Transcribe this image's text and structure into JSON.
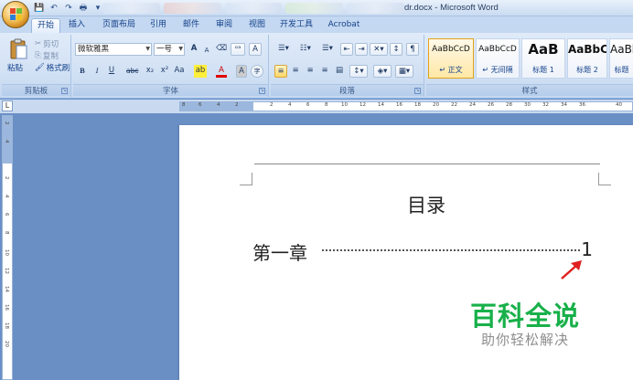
{
  "window": {
    "title": "dr.docx - Microsoft Word"
  },
  "quick_access": {
    "save": "💾",
    "undo": "↶",
    "redo": "↷",
    "print": "🖶",
    "more": "▾"
  },
  "tabs": [
    "开始",
    "插入",
    "页面布局",
    "引用",
    "邮件",
    "审阅",
    "视图",
    "开发工具",
    "Acrobat"
  ],
  "clipboard": {
    "paste": "粘贴",
    "cut": "剪切",
    "copy": "复制",
    "format_painter": "格式刷",
    "group_label": "剪贴板"
  },
  "font": {
    "family": "微软雅黑",
    "size": "一号",
    "grow": "A",
    "shrink": "A",
    "phonetic": "ᵒᵃ",
    "char_border": "A",
    "bold": "B",
    "italic": "I",
    "underline": "U",
    "strike": "abc",
    "subscript": "x₂",
    "superscript": "x²",
    "change_case": "Aa",
    "highlight": "ab",
    "font_color": "A",
    "shading": "A",
    "enclose": "字",
    "group_label": "字体"
  },
  "paragraph": {
    "group_label": "段落"
  },
  "styles": {
    "group_label": "样式",
    "items": [
      {
        "sample": "AaBbCcD",
        "name": "↵ 正文"
      },
      {
        "sample": "AaBbCcD",
        "name": "↵ 无间隔"
      },
      {
        "sample": "AaB",
        "name": "标题 1"
      },
      {
        "sample": "AaBbC",
        "name": "标题 2"
      },
      {
        "sample": "AaBb",
        "name": "标题"
      }
    ]
  },
  "ruler": {
    "tab_marker": "L",
    "ticks": [
      "8",
      "6",
      "4",
      "2",
      "2",
      "4",
      "6",
      "8",
      "10",
      "12",
      "14",
      "16",
      "18",
      "20",
      "22",
      "24",
      "26",
      "28",
      "30",
      "32",
      "34",
      "36",
      "40"
    ],
    "vticks": [
      "2",
      "4",
      "2",
      "4",
      "6",
      "8",
      "10",
      "12",
      "14",
      "16",
      "18",
      "20"
    ]
  },
  "document": {
    "title": "目录",
    "toc": [
      {
        "label": "第一章",
        "page": "1"
      }
    ]
  },
  "watermark": {
    "main": "百科全说",
    "sub": "助你轻松解决"
  },
  "colors": {
    "accent": "#18b04a",
    "arrow": "#e02020",
    "ribbon": "#d2e1f4"
  }
}
